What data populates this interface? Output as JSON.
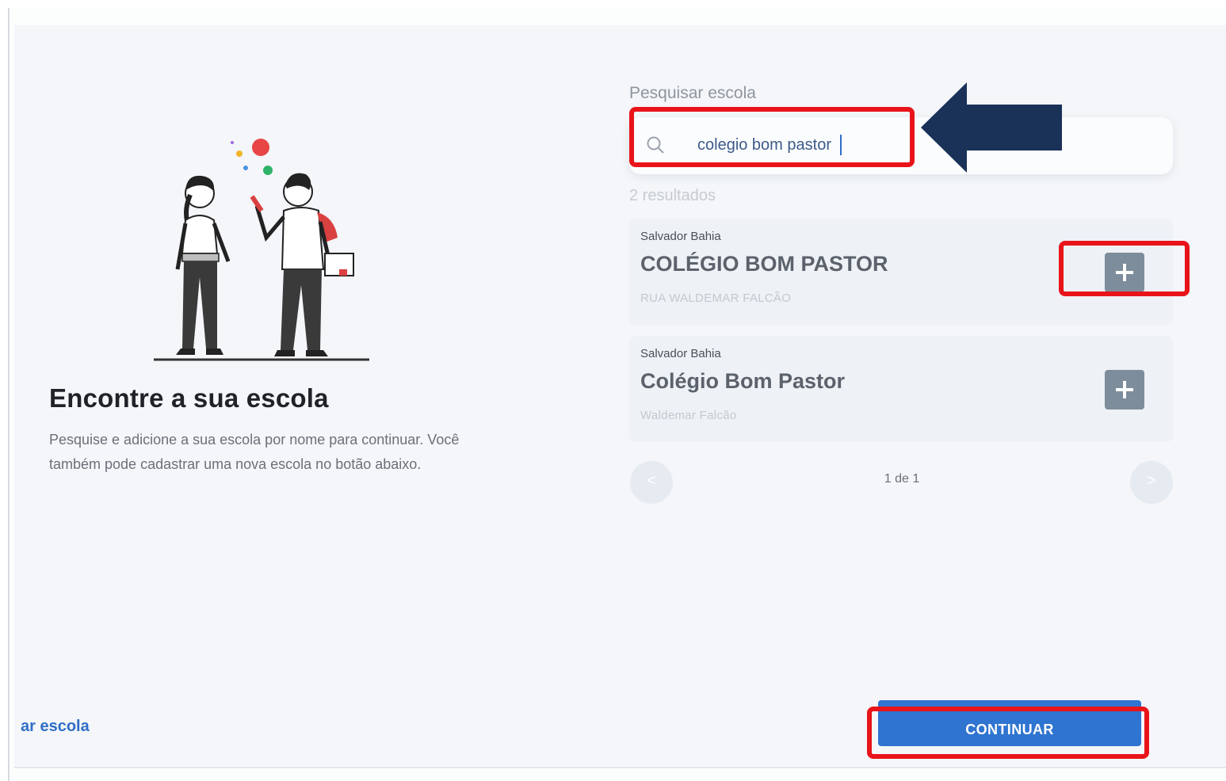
{
  "left": {
    "title": "Encontre a sua escola",
    "description": "Pesquise e adicione a sua escola por nome para continuar. Você também pode cadastrar uma nova escola no botão abaixo.",
    "register_link": "ar escola"
  },
  "search": {
    "label": "Pesquisar escola",
    "value": "colegio bom pastor",
    "icon": "search-icon"
  },
  "results": {
    "count_text": "2 resultados",
    "items": [
      {
        "city": "Salvador Bahia",
        "name": "COLÉGIO BOM PASTOR",
        "address": "RUA WALDEMAR FALCÃO",
        "add_label": "+"
      },
      {
        "city": "Salvador Bahia",
        "name": "Colégio Bom Pastor",
        "address": "Waldemar Falcão",
        "add_label": "+"
      }
    ]
  },
  "pager": {
    "text": "1 de 1",
    "prev": "<",
    "next": ">"
  },
  "actions": {
    "continue_label": "CONTINUAR"
  },
  "colors": {
    "accent": "#2f74d0",
    "highlight": "#e8141a",
    "arrow": "#1a3158"
  }
}
